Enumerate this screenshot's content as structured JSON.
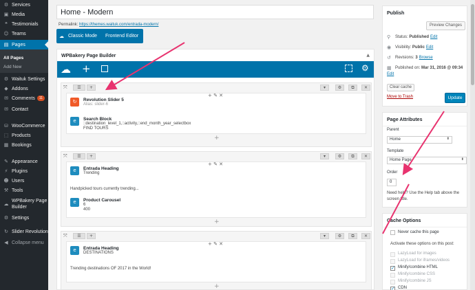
{
  "sidebar": {
    "items": [
      {
        "label": "Services",
        "icon": "services-icon",
        "glyph": "⚙"
      },
      {
        "label": "Media",
        "icon": "media-icon",
        "glyph": "▣"
      },
      {
        "label": "Testimonials",
        "icon": "testimonials-icon",
        "glyph": "❝"
      },
      {
        "label": "Teams",
        "icon": "teams-icon",
        "glyph": "☺"
      },
      {
        "label": "Pages",
        "icon": "pages-icon",
        "glyph": "▤"
      },
      {
        "label": "Waituk Settings",
        "icon": "waituk-settings-icon",
        "glyph": "⚙"
      },
      {
        "label": "Addons",
        "icon": "addons-icon",
        "glyph": "◆"
      },
      {
        "label": "Comments",
        "icon": "comments-icon",
        "glyph": "✉",
        "badge": "11"
      },
      {
        "label": "Contact",
        "icon": "contact-icon",
        "glyph": "✉"
      },
      {
        "label": "WooCommerce",
        "icon": "woocommerce-icon",
        "glyph": "⛁"
      },
      {
        "label": "Products",
        "icon": "products-icon",
        "glyph": "⬚"
      },
      {
        "label": "Bookings",
        "icon": "bookings-icon",
        "glyph": "▦"
      },
      {
        "label": "Appearance",
        "icon": "appearance-icon",
        "glyph": "✎"
      },
      {
        "label": "Plugins",
        "icon": "plugins-icon",
        "glyph": "⚡"
      },
      {
        "label": "Users",
        "icon": "users-icon",
        "glyph": "☻"
      },
      {
        "label": "Tools",
        "icon": "tools-icon",
        "glyph": "⚒"
      },
      {
        "label": "WPBakery Page",
        "label2": "Builder",
        "icon": "wpbakery-icon",
        "glyph": "☁"
      },
      {
        "label": "Settings",
        "icon": "settings-icon",
        "glyph": "⚙"
      },
      {
        "label": "Slider Revolution",
        "icon": "slider-revolution-icon",
        "glyph": "↻"
      },
      {
        "label": "Collapse menu",
        "icon": "collapse-icon",
        "glyph": "◀"
      }
    ],
    "sub": {
      "all_pages": "All Pages",
      "add_new": "Add New"
    }
  },
  "editor": {
    "title_value": "Home - Modern",
    "permalink_label": "Permalink:",
    "permalink_url": "https://themes.waituk.com/entrada-modern/",
    "classic_mode": "Classic Mode",
    "frontend_editor": "Frontend Editor",
    "builder_title": "WPBakery Page Builder"
  },
  "rows": [
    {
      "elements": [
        {
          "title": "Revolution Slider 5",
          "sub": "Alias: slider-6",
          "sub2": "",
          "color": "#f05a28",
          "glyph": "↻"
        },
        {
          "title": "Search Block",
          "sub": "::destination_level_1,::activity,::end_month_year_selectbox",
          "sub2": "FIND TOURS",
          "color": "#1e8cbe",
          "glyph": "e"
        }
      ]
    },
    {
      "elements": [
        {
          "title": "Entrada Heading",
          "sub": "Trending",
          "color": "#1e8cbe",
          "glyph": "e"
        },
        {
          "text": "Handpicked tours currently trending..."
        },
        {
          "title": "Product Carousel",
          "sub": "6",
          "sub2": "400",
          "color": "#1e8cbe",
          "glyph": "e"
        }
      ]
    },
    {
      "elements": [
        {
          "title": "Entrada Heading",
          "sub": "DESTINATIONS",
          "color": "#1e8cbe",
          "glyph": "e"
        },
        {
          "text": "Trending destinations OF 2017 in the World!"
        }
      ]
    }
  ],
  "publish": {
    "title": "Publish",
    "preview": "Preview Changes",
    "status_label": "Status:",
    "status_value": "Published",
    "visibility_label": "Visibility:",
    "visibility_value": "Public",
    "revisions_label": "Revisions:",
    "revisions_value": "3",
    "browse": "Browse",
    "published_on": "Published on:",
    "published_date": "Mar 31, 2016 @ 09:34",
    "edit": "Edit",
    "clear_cache": "Clear cache",
    "move_trash": "Move to Trash",
    "update": "Update"
  },
  "page_attributes": {
    "title": "Page Attributes",
    "parent_label": "Parent",
    "parent_value": "Home",
    "template_label": "Template",
    "template_value": "Home Page",
    "order_label": "Order",
    "order_value": "0",
    "help": "Need help? Use the Help tab above the screen title."
  },
  "cache_options": {
    "title": "Cache Options",
    "never_cache": "Never cache this page",
    "activate": "Activate these options on this post:",
    "options": [
      {
        "label": "LazyLoad for images",
        "checked": false,
        "disabled": true
      },
      {
        "label": "LazyLoad for iframes/videos",
        "checked": false,
        "disabled": true
      },
      {
        "label": "Minify/combine HTML",
        "checked": true,
        "disabled": false
      },
      {
        "label": "Minify/combine CSS",
        "checked": false,
        "disabled": true
      },
      {
        "label": "Minify/combine JS",
        "checked": false,
        "disabled": true
      },
      {
        "label": "CDN",
        "checked": true,
        "disabled": false
      }
    ]
  },
  "colors": {
    "accent": "#0073aa",
    "annotation": "#e8336f",
    "update_button": "#0085ba"
  }
}
